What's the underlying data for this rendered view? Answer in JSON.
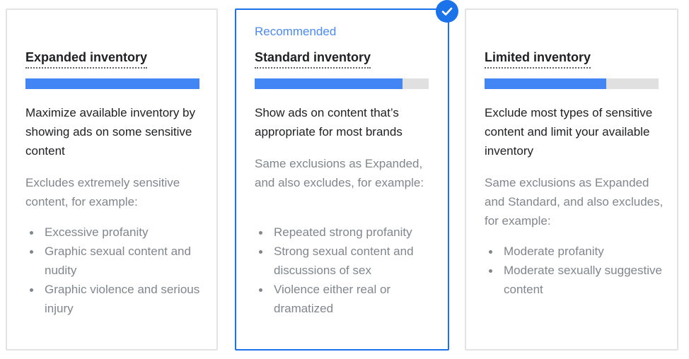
{
  "accent_color": "#1a73e8",
  "selected_card": "standard",
  "cards": [
    {
      "recommended_label": "",
      "title": "Expanded inventory",
      "inventory_level": 1.0,
      "headline": "Maximize available inventory by showing ads on some sensitive content",
      "note": "Excludes extremely sensitive content, for example:",
      "examples": [
        "Excessive profanity",
        "Graphic sexual content and nudity",
        "Graphic violence and serious injury"
      ]
    },
    {
      "recommended_label": "Recommended",
      "title": "Standard inventory",
      "inventory_level": 0.85,
      "headline": "Show ads on content that’s appropriate for most brands",
      "note": "Same exclusions as Expanded, and also excludes, for example:",
      "examples": [
        "Repeated strong profanity",
        "Strong sexual content and discussions of sex",
        "Violence either real or dramatized"
      ]
    },
    {
      "recommended_label": "",
      "title": "Limited inventory",
      "inventory_level": 0.7,
      "headline": "Exclude most types of sensitive content and limit your available inventory",
      "note": "Same exclusions as Expanded and Standard, and also excludes, for example:",
      "examples": [
        "Moderate profanity",
        "Moderate sexually suggestive content"
      ]
    }
  ],
  "icons": {
    "selected": "check-icon"
  }
}
